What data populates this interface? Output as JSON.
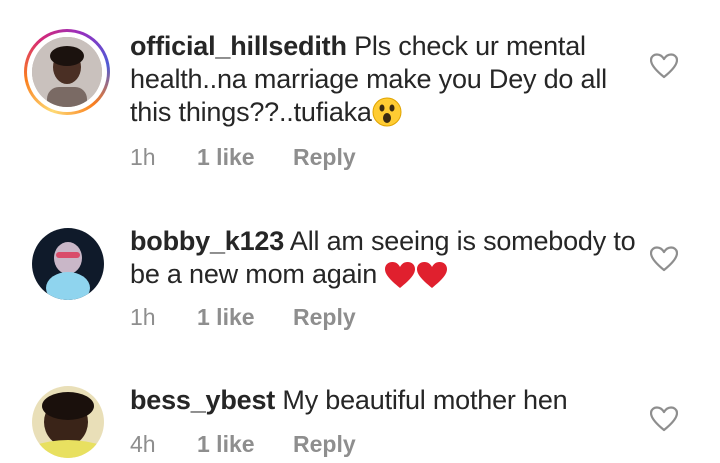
{
  "comments": [
    {
      "username": "official_hillsedith",
      "text": "Pls check ur mental health..na marriage make you Dey do all this things??..tufiaka",
      "time": "1h",
      "likes": "1 like",
      "reply": "Reply",
      "emoji": "astonished-face"
    },
    {
      "username": "bobby_k123",
      "text": "All am seeing is somebody to be a new mom again",
      "time": "1h",
      "likes": "1 like",
      "reply": "Reply",
      "emoji": "two-red-hearts"
    },
    {
      "username": "bess_ybest",
      "text": "My beautiful mother hen",
      "time": "4h",
      "likes": "1 like",
      "reply": "Reply"
    }
  ],
  "colors": {
    "text": "#262626",
    "meta": "#8e8e8e",
    "heart_red": "#e0202e"
  }
}
